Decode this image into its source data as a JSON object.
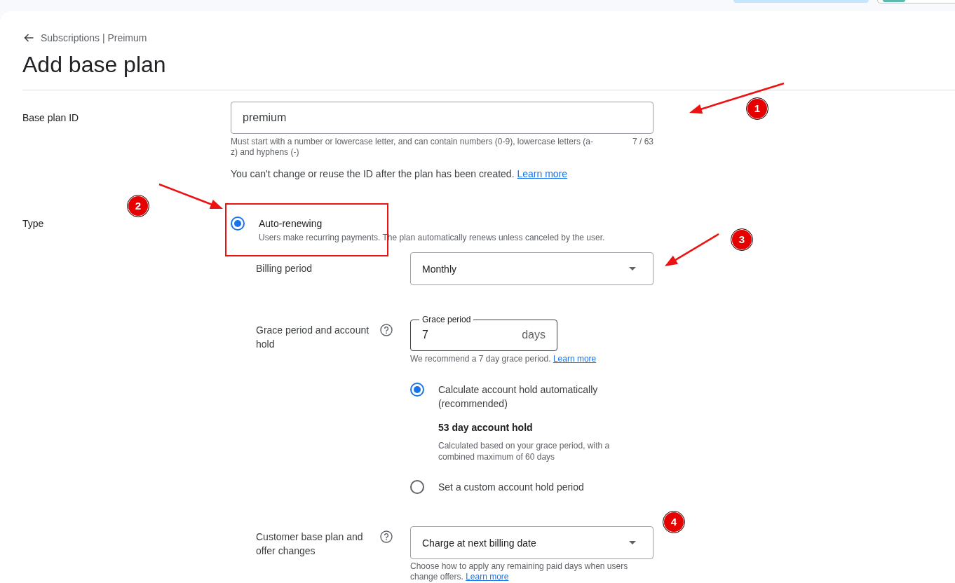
{
  "breadcrumb": "Subscriptions | Preimum",
  "title": "Add base plan",
  "base_plan_id": {
    "label": "Base plan ID",
    "value": "premium",
    "helper": "Must start with a number or lowercase letter, and can contain numbers (0-9), lowercase letters (a-z) and hyphens (-)",
    "counter": "7 / 63",
    "note": "You can't change or reuse the ID after the plan has been created.",
    "link": "Learn more"
  },
  "type": {
    "label": "Type",
    "options": [
      {
        "label": "Auto-renewing",
        "description": "Users make recurring payments. The plan automatically renews unless canceled by the user.",
        "selected": true,
        "highlighted": true
      }
    ],
    "billing_period": {
      "label": "Billing period",
      "value": "Monthly"
    },
    "grace_period": {
      "label": "Grace period and account hold",
      "field_label": "Grace period",
      "value": "7",
      "suffix": "days",
      "helper": "We recommend a 7 day grace period.",
      "link": "Learn more"
    },
    "account_hold": {
      "options": [
        {
          "label": "Calculate account hold automatically (recommended)",
          "selected": true,
          "summary": "53 day account hold",
          "detail": "Calculated based on your grace period, with a combined maximum of 60 days"
        },
        {
          "label": "Set a custom account hold period",
          "selected": false
        }
      ]
    },
    "plan_changes": {
      "label": "Customer base plan and offer changes",
      "value": "Charge at next billing date",
      "helper": "Choose how to apply any remaining paid days when users change offers.",
      "link": "Learn more"
    }
  },
  "annotations": {
    "markers": [
      {
        "label": "1",
        "arrow": true
      },
      {
        "label": "2",
        "arrow": true
      },
      {
        "label": "3",
        "arrow": true
      },
      {
        "label": "4",
        "arrow": false
      }
    ]
  }
}
